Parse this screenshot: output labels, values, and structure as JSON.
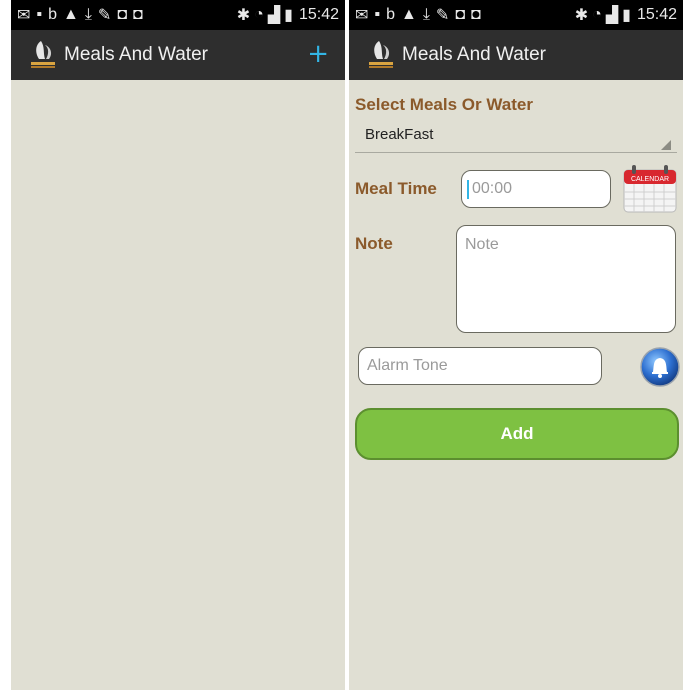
{
  "status": {
    "time": "15:42"
  },
  "left_screen": {
    "title": "Meals And Water",
    "add_icon_glyph": "+",
    "logo_icon": "elderly-app-logo-icon"
  },
  "right_screen": {
    "title": "Meals And Water",
    "logo_icon": "elderly-app-logo-icon",
    "select_label": "Select Meals Or Water",
    "selected_meal": "BreakFast",
    "meal_time_label": "Meal Time",
    "meal_time_placeholder": "00:00",
    "calendar_icon_text": "CALENDAR",
    "note_label": "Note",
    "note_placeholder": "Note",
    "alarm_placeholder": "Alarm Tone",
    "alarm_icon": "bell-icon",
    "add_button": "Add"
  },
  "colors": {
    "background": "#e0dfd3",
    "actionbar": "#2e2e2e",
    "label_brown": "#8b5a2b",
    "button_green": "#7ec142",
    "accent_blue": "#33b5e5"
  }
}
